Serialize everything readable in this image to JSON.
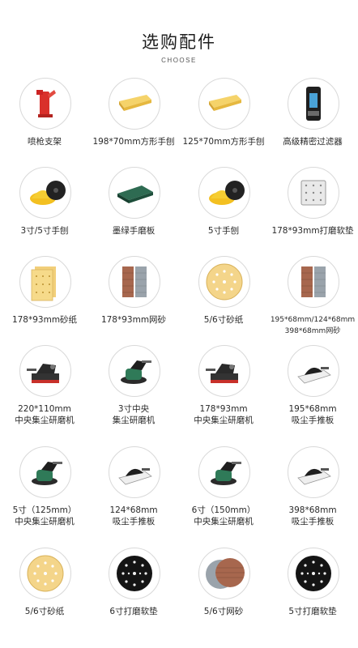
{
  "header": {
    "title": "选购配件",
    "subtitle": "CHOOSE"
  },
  "items": [
    {
      "lines": [
        "喷枪支架"
      ],
      "icon": "spray-gun-holder-icon"
    },
    {
      "lines": [
        "198*70mm方形手刨"
      ],
      "icon": "rectangular-hand-planer-icon"
    },
    {
      "lines": [
        "125*70mm方形手刨"
      ],
      "icon": "rectangular-hand-planer-icon"
    },
    {
      "lines": [
        "高级精密过滤器"
      ],
      "icon": "precision-filter-icon"
    },
    {
      "lines": [
        "3寸/5寸手刨"
      ],
      "icon": "round-hand-planer-icon"
    },
    {
      "lines": [
        "墨绿手磨板"
      ],
      "icon": "green-sanding-board-icon"
    },
    {
      "lines": [
        "5寸手刨"
      ],
      "icon": "round-hand-planer-icon"
    },
    {
      "lines": [
        "178*93mm打磨软垫"
      ],
      "icon": "sanding-pad-icon"
    },
    {
      "lines": [
        "178*93mm砂纸"
      ],
      "icon": "sandpaper-icon"
    },
    {
      "lines": [
        "178*93mm网砂"
      ],
      "icon": "mesh-sandpaper-icon"
    },
    {
      "lines": [
        "5/6寸砂纸"
      ],
      "icon": "round-sandpaper-icon"
    },
    {
      "lines": [
        "195*68mm/124*68mm",
        "398*68mm网砂"
      ],
      "icon": "mesh-sandpaper-icon"
    },
    {
      "lines": [
        "220*110mm",
        "中央集尘研磨机"
      ],
      "icon": "sander-machine-icon"
    },
    {
      "lines": [
        "3寸中央",
        "集尘研磨机"
      ],
      "icon": "orbital-sander-icon"
    },
    {
      "lines": [
        "178*93mm",
        "中央集尘研磨机"
      ],
      "icon": "sander-machine-icon"
    },
    {
      "lines": [
        "195*68mm",
        "吸尘手推板"
      ],
      "icon": "dust-hand-board-icon"
    },
    {
      "lines": [
        "5寸（125mm）",
        "中央集尘研磨机"
      ],
      "icon": "orbital-sander-icon"
    },
    {
      "lines": [
        "124*68mm",
        "吸尘手推板"
      ],
      "icon": "dust-hand-board-icon"
    },
    {
      "lines": [
        "6寸（150mm）",
        "中央集尘研磨机"
      ],
      "icon": "orbital-sander-icon"
    },
    {
      "lines": [
        "398*68mm",
        "吸尘手推板"
      ],
      "icon": "dust-hand-board-icon"
    },
    {
      "lines": [
        "5/6寸砂纸"
      ],
      "icon": "round-sandpaper-icon"
    },
    {
      "lines": [
        "6寸打磨软垫"
      ],
      "icon": "round-sanding-pad-icon"
    },
    {
      "lines": [
        "5/6寸网砂"
      ],
      "icon": "round-mesh-sandpaper-icon"
    },
    {
      "lines": [
        "5寸打磨软垫"
      ],
      "icon": "round-sanding-pad-icon"
    }
  ]
}
